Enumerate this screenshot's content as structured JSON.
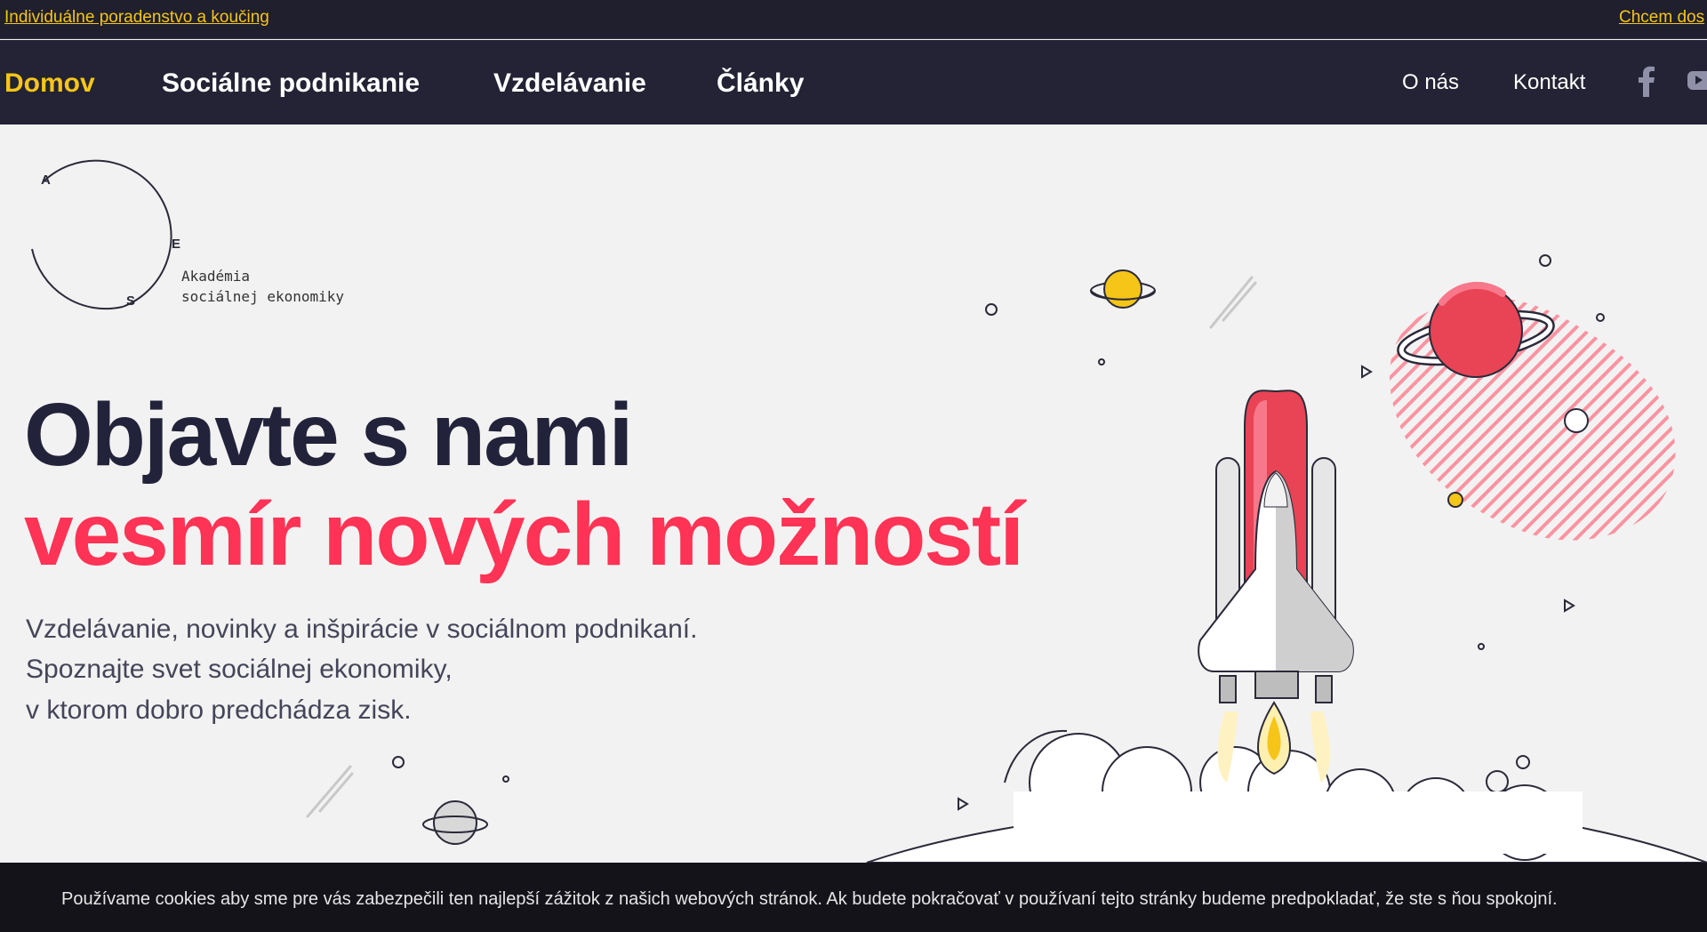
{
  "topbar": {
    "left_link": "Individuálne poradenstvo a koučing",
    "right_link": "Chcem dos"
  },
  "nav": {
    "items": [
      {
        "label": "Domov",
        "active": true
      },
      {
        "label": "Sociálne podnikanie"
      },
      {
        "label": "Vzdelávanie"
      },
      {
        "label": "Články"
      }
    ],
    "secondary": [
      {
        "label": "O nás"
      },
      {
        "label": "Kontakt"
      }
    ],
    "social_icons": [
      "facebook-icon",
      "youtube-icon"
    ]
  },
  "logo": {
    "letters": [
      "A",
      "E",
      "S"
    ],
    "line1": "Akadémia",
    "line2": "sociálnej ekonomiky"
  },
  "hero": {
    "title_line1": "Objavte s nami",
    "title_line2": "vesmír nových možností",
    "subtitle": [
      "Vzdelávanie, novinky a inšpirácie v sociálnom podnikaní.",
      "Spoznajte svet sociálnej ekonomiky,",
      "v ktorom dobro predchádza zisk."
    ]
  },
  "cookie": {
    "text": "Používame cookies aby sme pre vás zabezpečili ten najlepší zážitok z našich webových stránok. Ak budete pokračovať v používaní tejto stránky budeme predpokladať, že ste s ňou spokojní."
  },
  "colors": {
    "accent_yellow": "#f5c518",
    "accent_red": "#ff3355",
    "nav_bg": "#232335",
    "page_bg": "#f2f2f2"
  }
}
